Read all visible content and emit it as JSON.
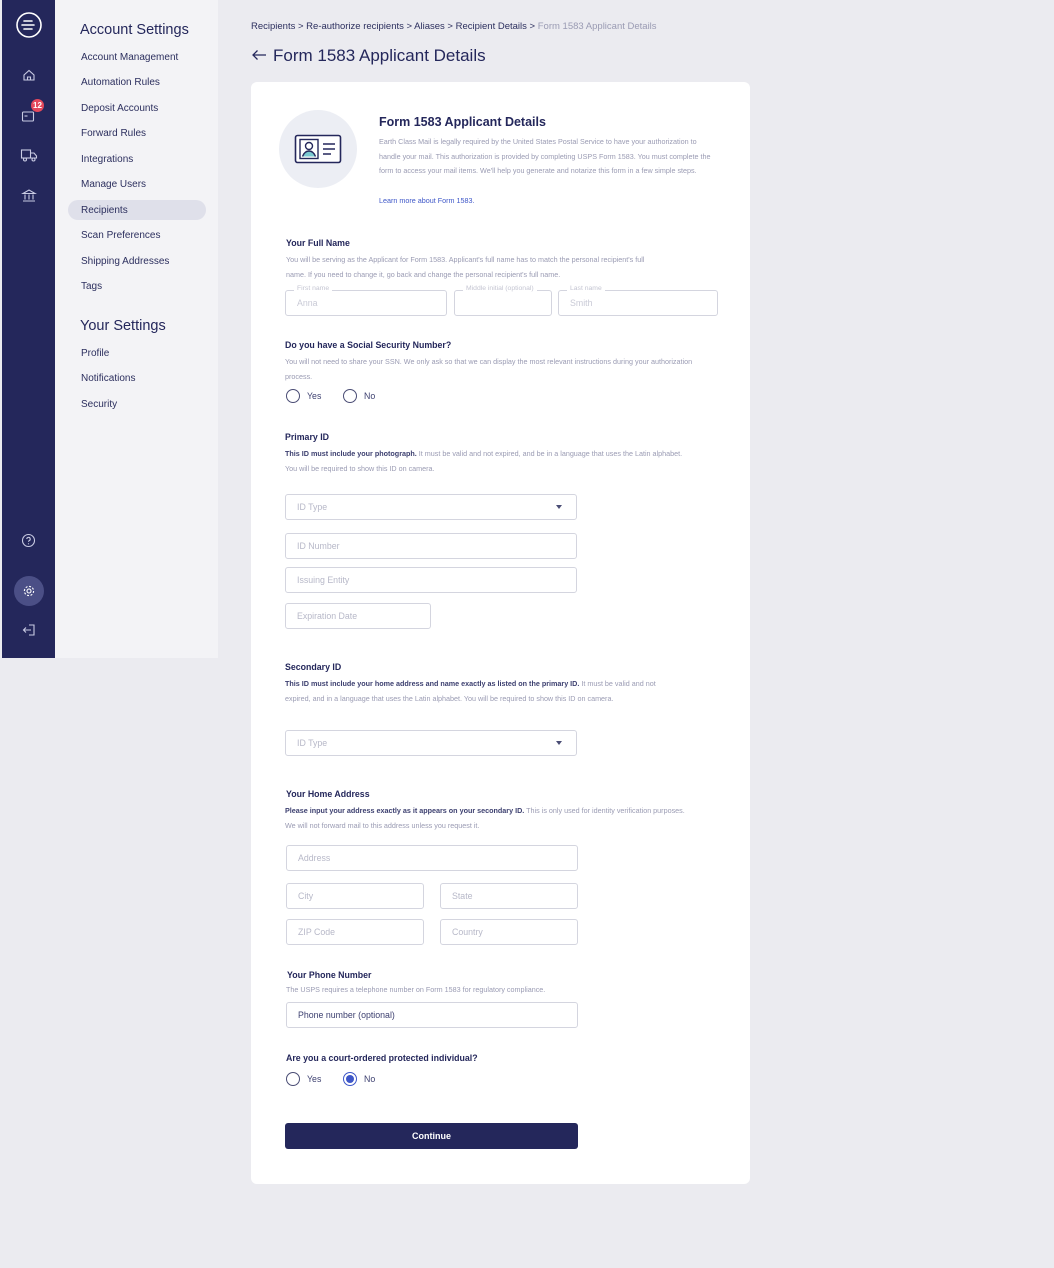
{
  "nav": {
    "notifications_count": "12",
    "icons": [
      "logo-icon",
      "home-icon",
      "inbox-icon",
      "truck-icon",
      "bank-icon",
      "help-icon",
      "gear-icon",
      "logout-icon"
    ]
  },
  "sidebar": {
    "account_heading": "Account Settings",
    "account_items": [
      {
        "label": "Account Management"
      },
      {
        "label": "Automation Rules"
      },
      {
        "label": "Deposit Accounts"
      },
      {
        "label": "Forward Rules"
      },
      {
        "label": "Integrations"
      },
      {
        "label": "Manage Users"
      },
      {
        "label": "Recipients"
      },
      {
        "label": "Scan Preferences"
      },
      {
        "label": "Shipping Addresses"
      },
      {
        "label": "Tags"
      }
    ],
    "your_heading": "Your Settings",
    "your_items": [
      {
        "label": "Profile"
      },
      {
        "label": "Notifications"
      },
      {
        "label": "Security"
      }
    ]
  },
  "breadcrumb": {
    "trail": "Recipients > Re-authorize recipients > Aliases > Recipient Details >",
    "current": "Form 1583 Applicant Details"
  },
  "page_title": "Form 1583 Applicant Details",
  "intro": {
    "title": "Form 1583 Applicant Details",
    "body": "Earth Class Mail is legally required by the United States Postal Service to have your authorization to handle your mail. This authorization is provided by completing USPS Form 1583. You must complete the form to access your mail items. We'll help you generate and notarize this form in a few simple steps.",
    "link": "Learn more about Form 1583."
  },
  "full_name": {
    "title": "Your Full Name",
    "desc": "You will be serving as the Applicant for Form 1583. Applicant's full name has to match the personal recipient's full name. If you need to change it, go back and change the personal recipient's full name.",
    "first_label": "First name",
    "first_value": "Anna",
    "middle_label": "Middle initial (optional)",
    "middle_value": "",
    "last_label": "Last name",
    "last_value": "Smith"
  },
  "ssn": {
    "title": "Do you have a Social Security Number?",
    "desc": "You will not need to share your SSN. We only ask so that we can display the most relevant instructions during your authorization process.",
    "yes": "Yes",
    "no": "No"
  },
  "primary_id": {
    "title": "Primary ID",
    "desc_bold": "This ID must include your photograph.",
    "desc_rest": " It must be valid and not expired, and be in a language that uses the Latin alphabet. You will be required to show this ID on camera.",
    "id_type": "ID Type",
    "id_number": "ID Number",
    "issuing_entity": "Issuing Entity",
    "expiration": "Expiration Date"
  },
  "secondary_id": {
    "title": "Secondary ID",
    "desc_bold": "This ID must include your home address and name exactly as listed on the primary ID.",
    "desc_rest": " It must be valid and not expired, and in a language that uses the Latin alphabet. You will be required to show this ID on camera.",
    "id_type": "ID Type"
  },
  "home_address": {
    "title": "Your Home Address",
    "desc_bold": "Please input your address exactly as it appears on your secondary ID.",
    "desc_rest": " This is only used for identity verification purposes. We will not forward mail to this address unless you request it.",
    "address": "Address",
    "city": "City",
    "state": "State",
    "zip": "ZIP Code",
    "country": "Country"
  },
  "phone": {
    "title": "Your Phone Number",
    "desc": "The USPS requires a telephone number on Form 1583 for regulatory compliance.",
    "placeholder": "Phone number (optional)"
  },
  "protected": {
    "title": "Are you a court-ordered protected individual?",
    "yes": "Yes",
    "no": "No",
    "selected": "No"
  },
  "continue_label": "Continue"
}
